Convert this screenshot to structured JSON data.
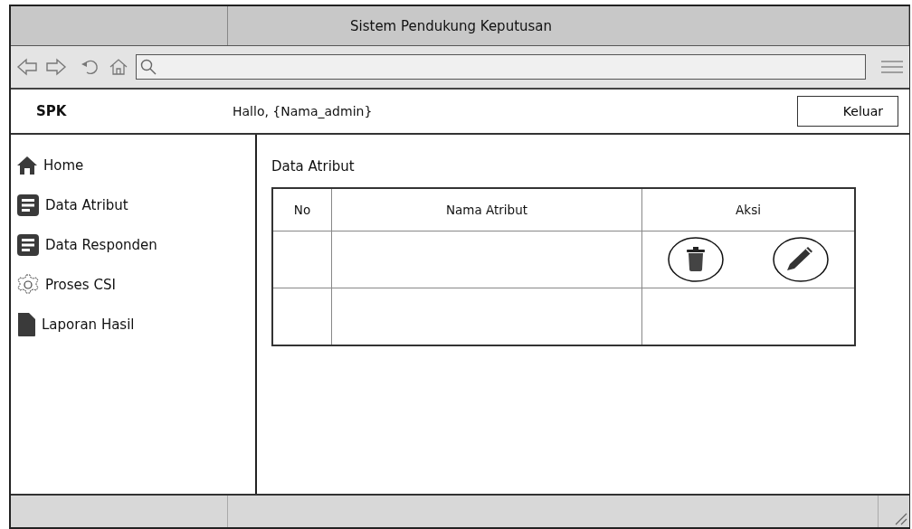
{
  "window": {
    "title": "Sistem Pendukung Keputusan"
  },
  "header": {
    "brand": "SPK",
    "greeting": "Hallo, {Nama_admin}",
    "logout_button": "Keluar"
  },
  "sidebar": {
    "items": [
      {
        "label": "Home",
        "kind": "home"
      },
      {
        "label": "Data Atribut",
        "kind": "list"
      },
      {
        "label": "Data Responden",
        "kind": "list"
      },
      {
        "label": "Proses CSI",
        "kind": "gear"
      },
      {
        "label": "Laporan Hasil",
        "kind": "file"
      }
    ]
  },
  "main": {
    "heading": "Data Atribut",
    "table": {
      "columns": [
        "No",
        "Nama Atribut",
        "Aksi"
      ],
      "rows": [
        {
          "kind": "actions"
        },
        {
          "kind": "empty"
        }
      ]
    }
  }
}
